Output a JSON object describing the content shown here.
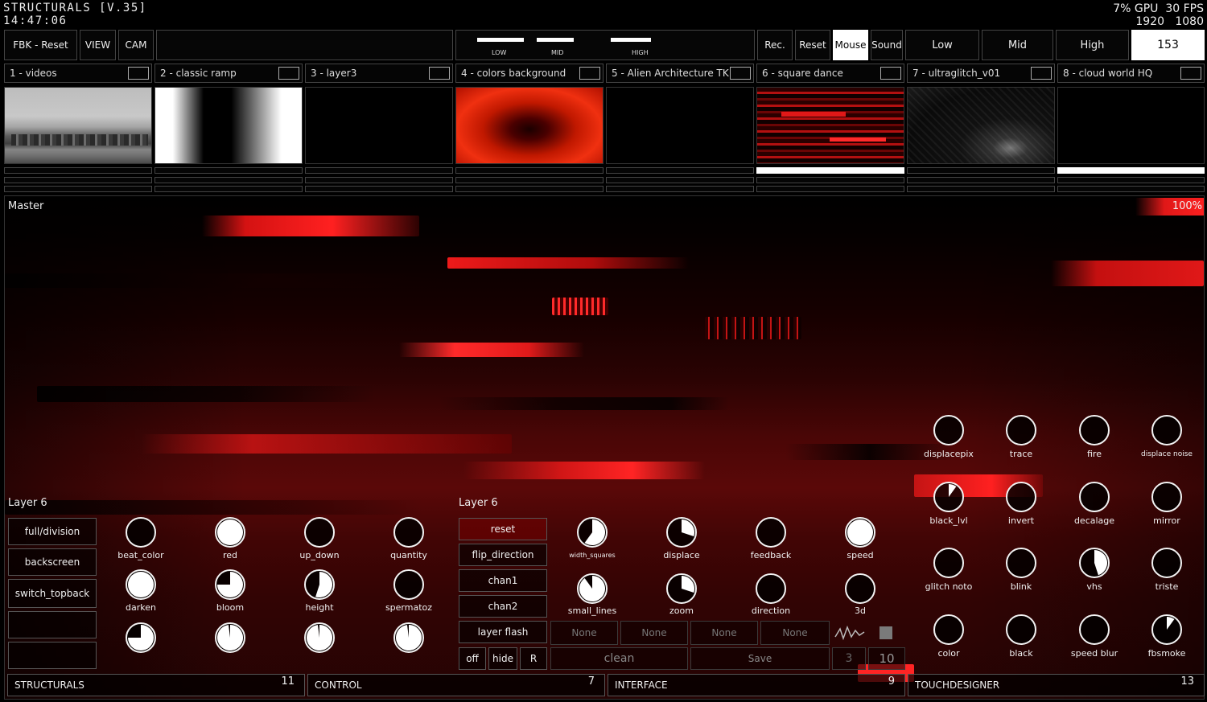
{
  "app": {
    "title": "STRUCTURALS [V.35]",
    "clock": "14:47:06"
  },
  "perf": {
    "gpu": "7% GPU",
    "fps": "30 FPS",
    "width": "1920",
    "height": "1080"
  },
  "toolbar": {
    "fbk_reset": "FBK - Reset",
    "view": "VIEW",
    "cam": "CAM",
    "levels": [
      {
        "label": "LOW",
        "level": 0.72
      },
      {
        "label": "MID",
        "level": 0.58
      },
      {
        "label": "HIGH",
        "level": 0.62
      }
    ],
    "rec": "Rec.",
    "reset": "Reset",
    "mouse": "Mouse",
    "sound": "Sound",
    "low": "Low",
    "mid": "Mid",
    "high": "High",
    "counter": "153"
  },
  "layers": [
    {
      "label": "1 - videos"
    },
    {
      "label": "2 - classic ramp"
    },
    {
      "label": "3 - layer3"
    },
    {
      "label": "4 - colors background"
    },
    {
      "label": "5 - Alien Architecture TK"
    },
    {
      "label": "6 - square dance"
    },
    {
      "label": "7 - ultraglitch_v01"
    },
    {
      "label": "8 - cloud world HQ"
    }
  ],
  "master": {
    "label": "Master",
    "opacity": "100%"
  },
  "panel_left": {
    "title": "Layer 6",
    "buttons": [
      "full/division",
      "backscreen",
      "switch_topback",
      "",
      ""
    ],
    "knobs": [
      {
        "label": "beat_color",
        "value": 0.0
      },
      {
        "label": "red",
        "value": 1.0
      },
      {
        "label": "up_down",
        "value": 0.0
      },
      {
        "label": "quantity",
        "value": 0.0
      },
      {
        "label": "darken",
        "value": 1.0
      },
      {
        "label": "bloom",
        "value": 0.75
      },
      {
        "label": "height",
        "value": 0.55
      },
      {
        "label": "spermatoz",
        "value": 0.0
      },
      {
        "label": "",
        "value": 0.75
      },
      {
        "label": "",
        "value": 0.98
      },
      {
        "label": "",
        "value": 0.98
      },
      {
        "label": "",
        "value": 0.98
      }
    ]
  },
  "panel_mid": {
    "title": "Layer 6",
    "buttons": [
      "reset",
      "flip_direction",
      "chan1",
      "chan2",
      "layer flash"
    ],
    "small_buttons": [
      "off",
      "hide",
      "R"
    ],
    "knobs": [
      {
        "label": "width_squares",
        "value": 0.6
      },
      {
        "label": "displace",
        "value": 0.3
      },
      {
        "label": "feedback",
        "value": 0.0
      },
      {
        "label": "speed",
        "value": 1.0
      },
      {
        "label": "small_lines",
        "value": 0.9
      },
      {
        "label": "zoom",
        "value": 0.3
      },
      {
        "label": "direction",
        "value": 0.0
      },
      {
        "label": "3d",
        "value": 0.0
      }
    ],
    "selects": [
      "None",
      "None",
      "None",
      "None"
    ],
    "clean": "clean",
    "save": "Save",
    "num_a": "3",
    "num_b": "10"
  },
  "panel_right": {
    "knobs": [
      {
        "label": "displacepix",
        "value": 0.0
      },
      {
        "label": "trace",
        "value": 0.0
      },
      {
        "label": "fire",
        "value": 0.0
      },
      {
        "label": "displace noise",
        "value": 0.0
      },
      {
        "label": "black_lvl",
        "value": 0.1
      },
      {
        "label": "invert",
        "value": 0.0
      },
      {
        "label": "decalage",
        "value": 0.0
      },
      {
        "label": "mirror",
        "value": 0.0
      },
      {
        "label": "glitch noto",
        "value": 0.0
      },
      {
        "label": "blink",
        "value": 0.0
      },
      {
        "label": "vhs",
        "value": 0.45
      },
      {
        "label": "triste",
        "value": 0.0
      },
      {
        "label": "color",
        "value": 0.0
      },
      {
        "label": "black",
        "value": 0.0
      },
      {
        "label": "speed blur",
        "value": 0.0
      },
      {
        "label": "fbsmoke",
        "value": 0.1
      }
    ]
  },
  "footer": [
    {
      "label": "STRUCTURALS",
      "num": "11"
    },
    {
      "label": "CONTROL",
      "num": "7"
    },
    {
      "label": "INTERFACE",
      "num": "9"
    },
    {
      "label": "TOUCHDESIGNER",
      "num": "13"
    }
  ]
}
